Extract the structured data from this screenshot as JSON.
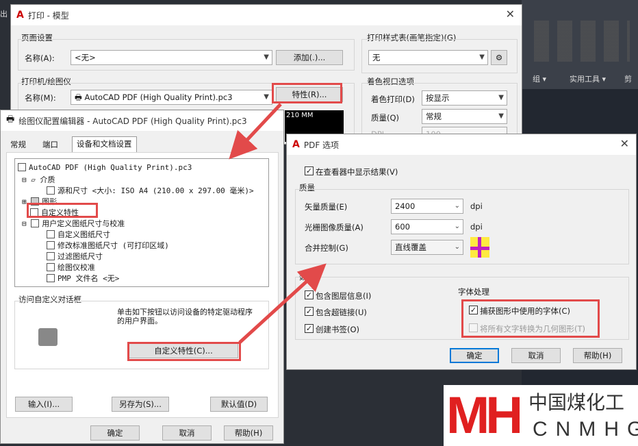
{
  "bg": {
    "top_left": "出",
    "ribbon_tabs": [
      "组 ▾",
      "实用工具 ▾",
      "剪"
    ]
  },
  "print": {
    "title": "打印 - 模型",
    "page_setup": {
      "group": "页面设置",
      "name_label": "名称(A):",
      "name_value": "<无>",
      "add_button": "添加(.)..."
    },
    "plotter": {
      "group": "打印机/绘图仪",
      "name_label": "名称(M):",
      "name_value": "AutoCAD PDF (High Quality Print).pc3",
      "props_button": "特性(R)...",
      "preview_label": "210 MM"
    },
    "style_table": {
      "group": "打印样式表(画笔指定)(G)",
      "value": "无"
    },
    "shaded": {
      "group": "着色视口选项",
      "shade_label": "着色打印(D)",
      "shade_value": "按显示",
      "quality_label": "质量(Q)",
      "quality_value": "常规",
      "dpi_label": "DPI",
      "dpi_value": "100"
    }
  },
  "editor": {
    "title": "绘图仪配置编辑器 - AutoCAD PDF (High Quality Print).pc3",
    "tabs": [
      "常规",
      "端口",
      "设备和文档设置"
    ],
    "tree": [
      "AutoCAD PDF (High Quality Print).pc3",
      "介质",
      "源和尺寸 <大小: ISO A4 (210.00 x 297.00 毫米)>",
      "图形",
      "自定义特性",
      "用户定义图纸尺寸与校准",
      "自定义图纸尺寸",
      "修改标准图纸尺寸 (可打印区域)",
      "过滤图纸尺寸",
      "绘图仪校准",
      "PMP 文件名 <无>"
    ],
    "access_group": "访问自定义对话框",
    "access_text": "单击如下按钮以访问设备的特定驱动程序的用户界面。",
    "custom_button": "自定义特性(C)...",
    "import_button": "输入(I)...",
    "saveas_button": "另存为(S)...",
    "default_button": "默认值(D)",
    "ok": "确定",
    "cancel": "取消",
    "help": "帮助(H)"
  },
  "pdf": {
    "title": "PDF 选项",
    "show_in_viewer": "在查看器中显示结果(V)",
    "quality_group": "质量",
    "vector_label": "矢量质量(E)",
    "vector_value": "2400",
    "raster_label": "光栅图像质量(A)",
    "raster_value": "600",
    "merge_label": "合并控制(G)",
    "merge_value": "直线覆盖",
    "dpi": "dpi",
    "data_group": "数",
    "layer_info": "包含图层信息(I)",
    "hyperlinks": "包含超链接(U)",
    "bookmarks": "创建书签(O)",
    "font_group": "字体处理",
    "capture_fonts": "捕获图形中使用的字体(C)",
    "convert_text": "将所有文字转换为几何图形(T)",
    "ok": "确定",
    "cancel": "取消",
    "help": "帮助(H)"
  },
  "watermark": {
    "cn": "中国煤化工",
    "en": "CNMHG"
  },
  "colors": {
    "highlight": "#e24a4a",
    "accent": "#0078d7",
    "logo": "#e02020"
  }
}
